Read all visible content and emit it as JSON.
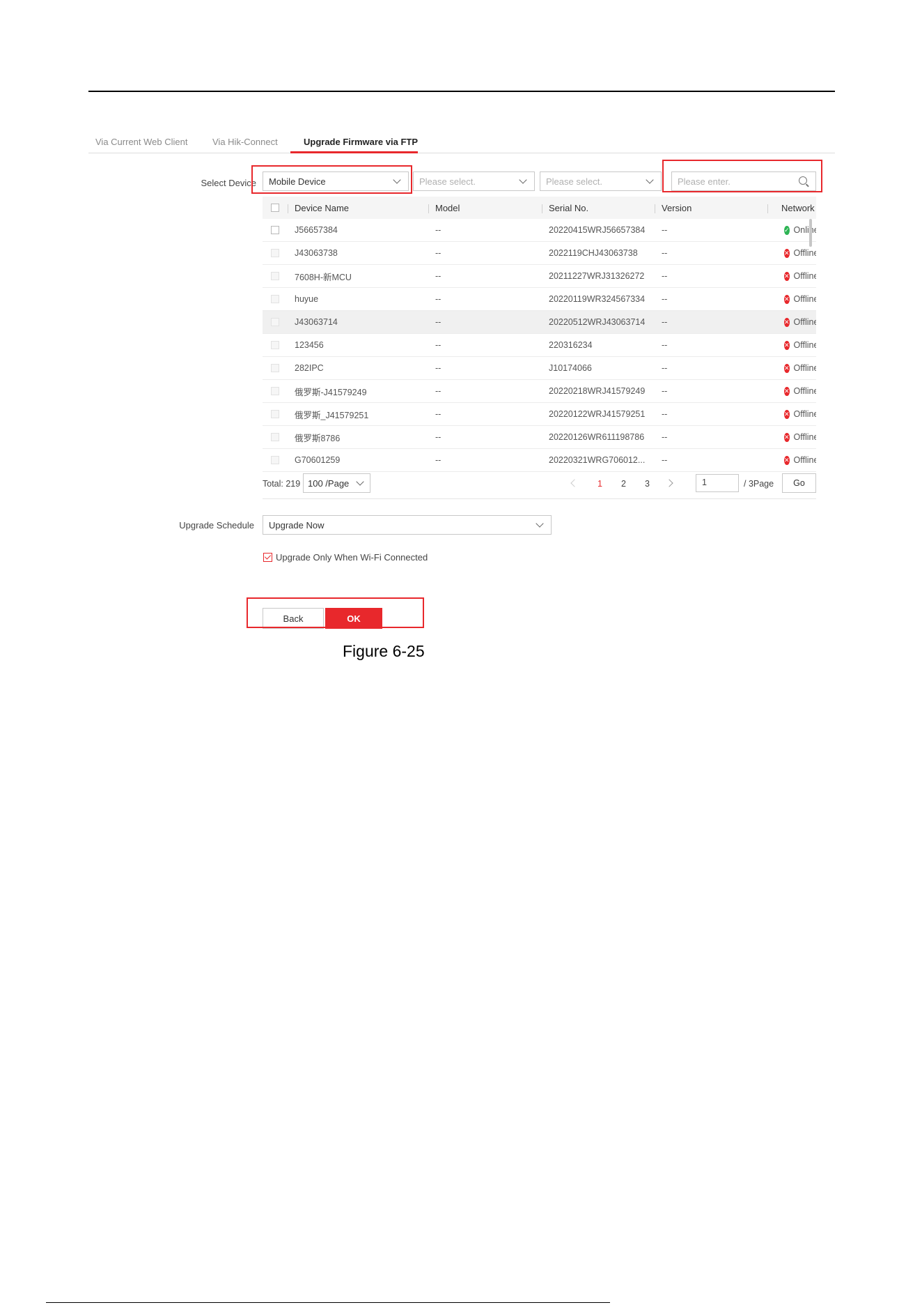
{
  "tabs": [
    {
      "label": "Via Current Web Client",
      "active": false
    },
    {
      "label": "Via Hik-Connect",
      "active": false
    },
    {
      "label": "Upgrade Firmware via FTP",
      "active": true
    }
  ],
  "select_device": {
    "label": "Select Device",
    "type_value": "Mobile Device",
    "filter1_placeholder": "Please select.",
    "filter2_placeholder": "Please select.",
    "search_placeholder": "Please enter."
  },
  "table": {
    "headers": {
      "device_name": "Device Name",
      "model": "Model",
      "serial": "Serial No.",
      "version": "Version",
      "status": "Network Status"
    },
    "rows": [
      {
        "name": "J56657384",
        "model": "--",
        "serial": "20220415WRJ56657384",
        "version": "--",
        "status": "Online"
      },
      {
        "name": "J43063738",
        "model": "--",
        "serial": "2022119CHJ43063738",
        "version": "--",
        "status": "Offline"
      },
      {
        "name": "7608H-新MCU",
        "model": "--",
        "serial": "20211227WRJ31326272",
        "version": "--",
        "status": "Offline"
      },
      {
        "name": "huyue",
        "model": "--",
        "serial": "20220119WR324567334",
        "version": "--",
        "status": "Offline"
      },
      {
        "name": "J43063714",
        "model": "--",
        "serial": "20220512WRJ43063714",
        "version": "--",
        "status": "Offline"
      },
      {
        "name": "123456",
        "model": "--",
        "serial": "220316234",
        "version": "--",
        "status": "Offline"
      },
      {
        "name": "282IPC",
        "model": "--",
        "serial": "J10174066",
        "version": "--",
        "status": "Offline"
      },
      {
        "name": "俄罗斯-J41579249",
        "model": "--",
        "serial": "20220218WRJ41579249",
        "version": "--",
        "status": "Offline"
      },
      {
        "name": "俄罗斯_J41579251",
        "model": "--",
        "serial": "20220122WRJ41579251",
        "version": "--",
        "status": "Offline"
      },
      {
        "name": "俄罗斯8786",
        "model": "--",
        "serial": "20220126WR611198786",
        "version": "--",
        "status": "Offline"
      },
      {
        "name": "G70601259",
        "model": "--",
        "serial": "20220321WRG706012...",
        "version": "--",
        "status": "Offline"
      }
    ]
  },
  "pagination": {
    "total": "Total: 219",
    "per_page": "100 /Page",
    "pages": [
      "1",
      "2",
      "3"
    ],
    "current_page": "1",
    "goto_value": "1",
    "page_count": "/ 3Page",
    "go_label": "Go"
  },
  "schedule": {
    "label": "Upgrade Schedule",
    "value": "Upgrade Now",
    "wifi_only_label": "Upgrade Only When Wi-Fi Connected"
  },
  "actions": {
    "back": "Back",
    "ok": "OK"
  },
  "caption": "Figure 6-25",
  "colors": {
    "accent": "#e8282c",
    "online": "#2db454",
    "offline": "#e8282c"
  }
}
